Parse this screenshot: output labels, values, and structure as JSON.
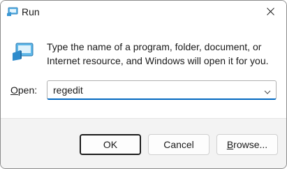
{
  "window": {
    "title": "Run",
    "app_icon": "run-app-icon",
    "close_icon": "close-icon"
  },
  "content": {
    "icon": "run-dialog-icon",
    "description": "Type the name of a program, folder, document, or Internet resource, and Windows will open it for you.",
    "open_label_prefix": "",
    "open_label_accel": "O",
    "open_label_rest": "pen:",
    "command_value": "regedit",
    "dropdown_icon": "chevron-down-icon"
  },
  "buttons": {
    "ok_label": "OK",
    "cancel_label": "Cancel",
    "browse_label_accel": "B",
    "browse_label_rest": "rowse..."
  },
  "colors": {
    "accent": "#0067c0",
    "footer_bg": "#f3f3f3"
  }
}
